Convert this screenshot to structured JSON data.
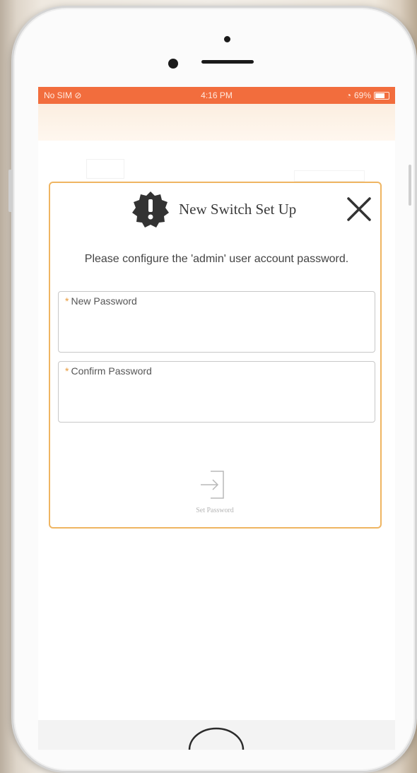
{
  "status_bar": {
    "carrier": "No SIM",
    "time": "4:16 PM",
    "battery": "69%"
  },
  "dialog": {
    "title": "New Switch Set Up",
    "instruction": "Please configure the 'admin' user account password.",
    "fields": [
      {
        "label": "New Password",
        "value": "",
        "required": "*"
      },
      {
        "label": "Confirm Password",
        "value": "",
        "required": "*"
      }
    ],
    "set_password_label": "Set Password"
  },
  "colors": {
    "status_bar": "#f26d3d",
    "dialog_border": "#efb562",
    "alert_icon": "#333333"
  },
  "icons": {
    "alert": "alert-badge-icon",
    "close": "close-icon",
    "set_password": "login-arrow-icon"
  }
}
